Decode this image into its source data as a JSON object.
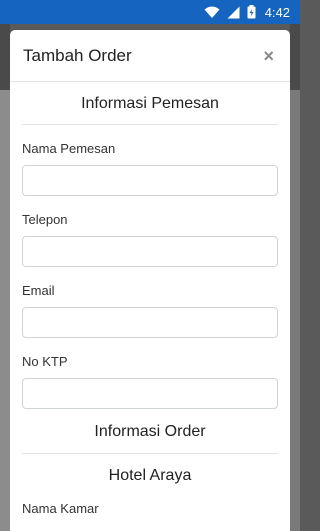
{
  "status_bar": {
    "time": "4:42",
    "icons": [
      "wifi-icon",
      "signal-icon",
      "battery-icon"
    ]
  },
  "modal": {
    "title": "Tambah Order",
    "close_label": "×",
    "sections": {
      "customer": {
        "heading": "Informasi Pemesan",
        "fields": {
          "name": {
            "label": "Nama Pemesan",
            "value": "",
            "placeholder": ""
          },
          "phone": {
            "label": "Telepon",
            "value": "",
            "placeholder": ""
          },
          "email": {
            "label": "Email",
            "value": "",
            "placeholder": ""
          },
          "ktp": {
            "label": "No KTP",
            "value": "",
            "placeholder": ""
          }
        }
      },
      "order": {
        "heading": "Informasi Order",
        "hotel_name": "Hotel Araya",
        "room_label": "Nama Kamar"
      }
    }
  },
  "colors": {
    "status_bar": "#1565c0",
    "input_border": "#cfd4da"
  }
}
